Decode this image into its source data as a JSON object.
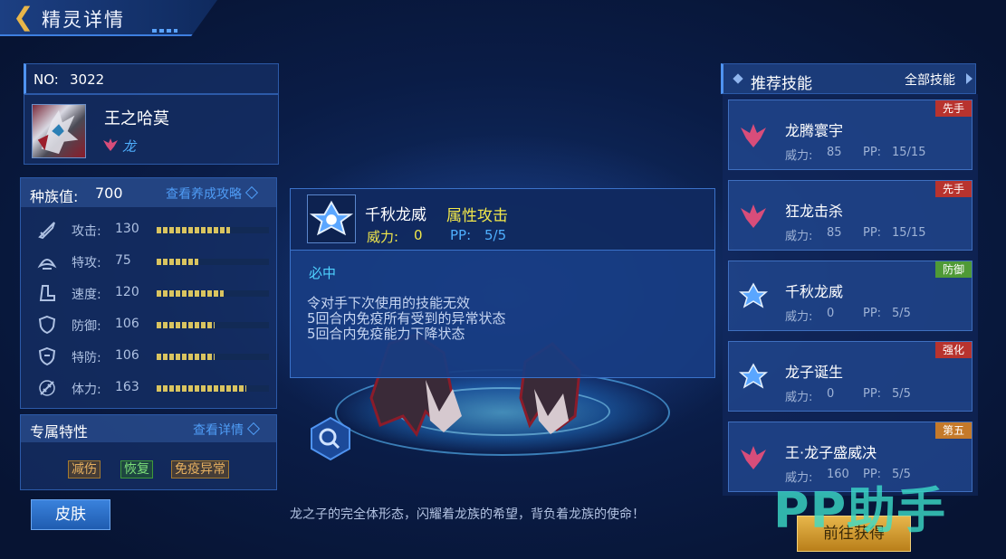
{
  "header": {
    "title": "精灵详情",
    "back_icon": "back-arrow-icon"
  },
  "pet": {
    "no_label": "NO:",
    "no": "3022",
    "name": "王之哈莫",
    "type": "龙"
  },
  "stats": {
    "total_label": "种族值:",
    "total": "700",
    "guide_link": "查看养成攻略",
    "rows": [
      {
        "icon": "attack-icon",
        "label": "攻击:",
        "value": "130",
        "fill": 0.65
      },
      {
        "icon": "special-attack-icon",
        "label": "特攻:",
        "value": "75",
        "fill": 0.37
      },
      {
        "icon": "speed-icon",
        "label": "速度:",
        "value": "120",
        "fill": 0.6
      },
      {
        "icon": "defense-icon",
        "label": "防御:",
        "value": "106",
        "fill": 0.52
      },
      {
        "icon": "special-defense-icon",
        "label": "特防:",
        "value": "106",
        "fill": 0.52
      },
      {
        "icon": "hp-icon",
        "label": "体力:",
        "value": "163",
        "fill": 0.8
      }
    ]
  },
  "traits": {
    "label": "专属特性",
    "detail_link": "查看详情",
    "tags": [
      "减伤",
      "恢复",
      "免疫异常"
    ]
  },
  "skin_button": "皮肤",
  "popup": {
    "name": "千秋龙威",
    "category": "属性攻击",
    "power_label": "威力:",
    "power": "0",
    "pp_label": "PP:",
    "pp": "5/5",
    "effect": "必中",
    "desc": [
      "令对手下次使用的技能无效",
      "5回合内免疫所有受到的异常状态",
      "5回合内免疫能力下降状态"
    ]
  },
  "description": "龙之子的完全体形态，闪耀着龙族的希望，背负着龙族的使命！",
  "skills_panel": {
    "title": "推荐技能",
    "all_link": "全部技能",
    "skills": [
      {
        "name": "龙腾寰宇",
        "power": "85",
        "pp": "15/15",
        "badge": "先手",
        "badge_color": "#b8332e",
        "icon": "dragon-skill-icon"
      },
      {
        "name": "狂龙击杀",
        "power": "85",
        "pp": "15/15",
        "badge": "先手",
        "badge_color": "#b8332e",
        "icon": "dragon-skill-icon"
      },
      {
        "name": "千秋龙威",
        "power": "0",
        "pp": "5/5",
        "badge": "防御",
        "badge_color": "#4f9a36",
        "icon": "star-skill-icon"
      },
      {
        "name": "龙子诞生",
        "power": "0",
        "pp": "5/5",
        "badge": "强化",
        "badge_color": "#b8332e",
        "icon": "star-skill-icon"
      },
      {
        "name": "王·龙子盛威决",
        "power": "160",
        "pp": "5/5",
        "badge": "第五",
        "badge_color": "#c4792a",
        "icon": "dragon-skill-icon"
      }
    ],
    "power_label": "威力:",
    "pp_label": "PP:"
  },
  "go_button": "前往获得",
  "watermark": "PP助手"
}
